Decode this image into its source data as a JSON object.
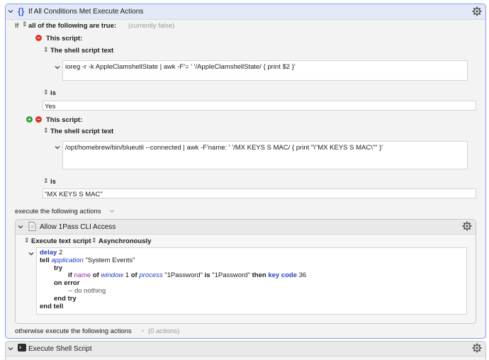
{
  "if_action": {
    "title": "If All Conditions Met Execute Actions",
    "if_label": "If",
    "match_mode": "all of the following are true:",
    "status": "(currently false)",
    "conditions": [
      {
        "heading": "This script:",
        "script_type": "The shell script text",
        "script": "ioreg -r -k AppleClamshellState | awk -F'= ' '/AppleClamshellState/ { print $2 }'",
        "operator": "is",
        "value": "Yes"
      },
      {
        "heading": "This script:",
        "script_type": "The shell script text",
        "script": "/opt/homebrew/bin/blueutil --connected | awk -F'name: ' '/MX KEYS S MAC/ { print \"\\\"MX KEYS S MAC\\\"\" }'",
        "operator": "is",
        "value": "\"MX KEYS S MAC\""
      }
    ],
    "execute_label": "execute the following actions",
    "otherwise_label": "otherwise execute the following actions",
    "otherwise_count": "(0 actions)"
  },
  "inner_action": {
    "title": "Allow 1Pass CLI Access",
    "mode_label": "Execute text script",
    "async_label": "Asynchronously",
    "code": {
      "l1_kw": "delay",
      "l1_val": "2",
      "l2_kw": "tell",
      "l2_app": "application",
      "l2_str": "\"System Events\"",
      "l3_kw": "try",
      "l4_if": "if",
      "l4_name": "name",
      "l4_of": "of",
      "l4_window": "window",
      "l4_num": "1",
      "l4_of2": "of",
      "l4_process": "process",
      "l4_str1": "\"1Password\"",
      "l4_is": "is",
      "l4_str2": "\"1Password\"",
      "l4_then": "then",
      "l4_keycode": "key code",
      "l4_code": "36",
      "l5_kw": "on error",
      "l6_cmt": "-- do nothing",
      "l7_kw": "end try",
      "l8_kw": "end tell"
    }
  },
  "next_action": {
    "title": "Execute Shell Script"
  },
  "colors": {
    "accent": "#3a63d8",
    "remove": "#d9352b",
    "add": "#34a03a"
  }
}
